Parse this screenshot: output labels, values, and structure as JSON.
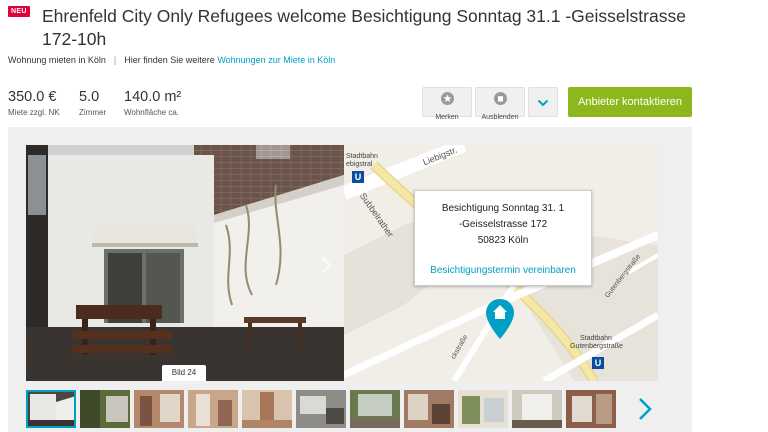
{
  "listing": {
    "badge": "NEU",
    "title": "Ehrenfeld City Only Refugees welcome Besichtigung Sonntag 31.1 -Geisselstrasse 172-10h"
  },
  "breadcrumb": {
    "category": "Wohnung mieten in Köln",
    "more_prefix": "Hier finden Sie weitere",
    "more_link": "Wohnungen zur Miete in Köln"
  },
  "facts": {
    "rent_value": "350.0 €",
    "rent_label": "Miete zzgl. NK",
    "rooms_value": "5.0",
    "rooms_label": "Zimmer",
    "area_value": "140.0 m²",
    "area_label": "Wohnfläche ca."
  },
  "actions": {
    "remember_label": "Merken",
    "hide_label": "Ausblenden",
    "contact_label": "Anbieter kontaktieren"
  },
  "gallery": {
    "image_label": "Bild 24",
    "thumbnail_count": 11
  },
  "map": {
    "popup_line1": "Besichtigung Sonntag 31. 1",
    "popup_line2": "-Geisselstrasse 172",
    "popup_line3": "50823 Köln",
    "popup_link": "Besichtigungstermin vereinbaren",
    "label_stadtbahn_top": "Stadtbahn",
    "label_stadtbahn_top2": "ebigstral",
    "label_liebig": "Liebigstr.",
    "label_subbelrather": "Subbelrather",
    "label_gutenberg": "Gutenbergstraße",
    "label_stadtbahn_bottom": "Stadtbahn",
    "label_stadtbahn_bottom2": "Gutenbergstraße",
    "label_street_bottom": "ckstraße",
    "transit_symbol": "U"
  },
  "colors": {
    "accent": "#00a0c6",
    "badge": "#e0003c",
    "contact": "#8cb81e"
  }
}
